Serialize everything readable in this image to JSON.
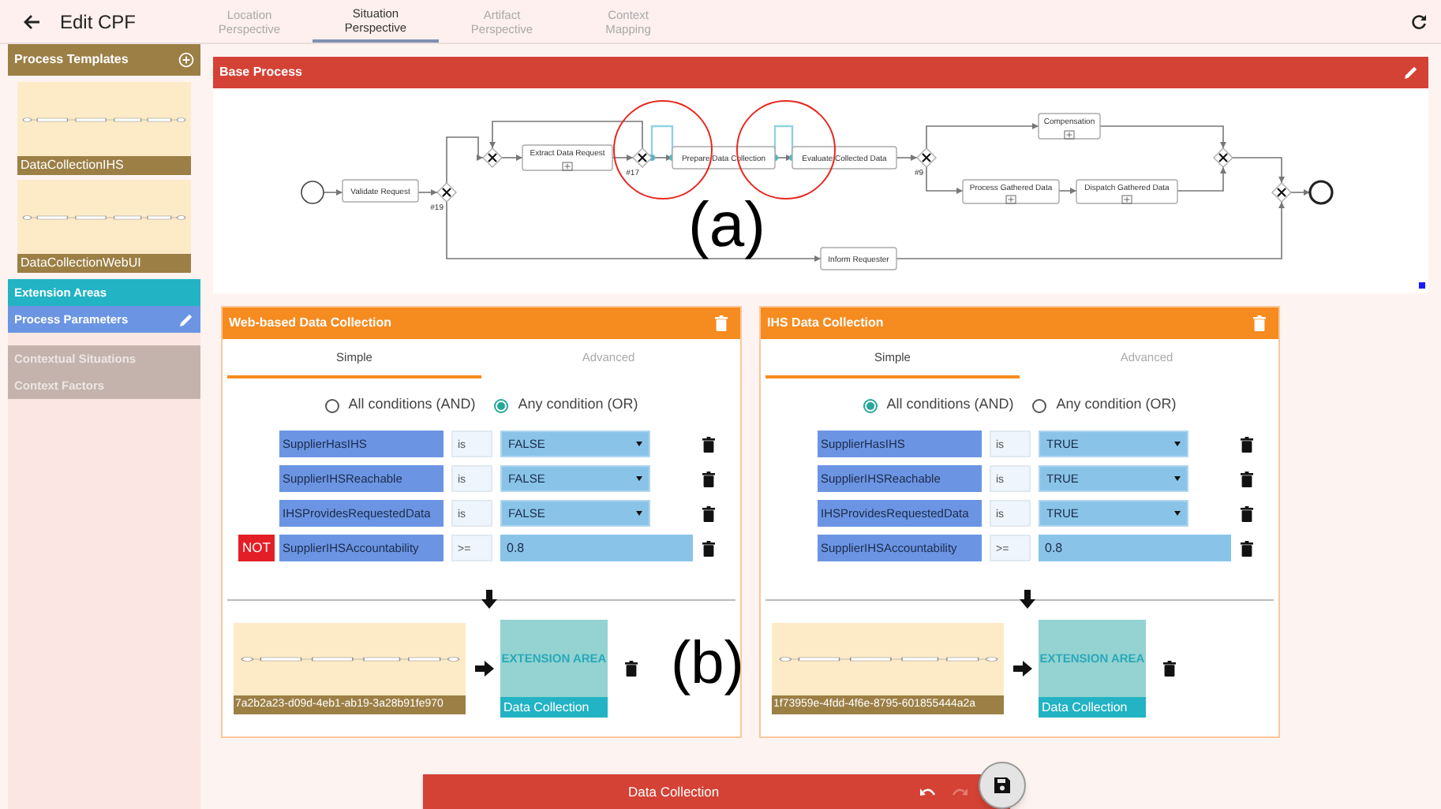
{
  "top_bar": {
    "title": "Edit CPF",
    "tabs": [
      {
        "label": "Location Perspective",
        "selected": false
      },
      {
        "label": "Situation Perspective",
        "selected": true
      },
      {
        "label": "Artifact Perspective",
        "selected": false
      },
      {
        "label": "Context Mapping",
        "selected": false
      }
    ]
  },
  "sidebar": {
    "templates_title": "Process Templates",
    "templates": [
      {
        "label": "DataCollectionIHS"
      },
      {
        "label": "DataCollectionWebUI"
      }
    ],
    "items": [
      {
        "label": "Extension Areas",
        "color": "#22b3c4",
        "editable": false,
        "disabled": false
      },
      {
        "label": "Process Parameters",
        "color": "#6b95e3",
        "editable": true,
        "disabled": false
      },
      {
        "label": "Contextual Situations",
        "editable": false,
        "disabled": true
      },
      {
        "label": "Context Factors",
        "editable": false,
        "disabled": true
      }
    ]
  },
  "base_process": {
    "title": "Base Process",
    "tasks": [
      {
        "label": "Validate Request",
        "subprocess": false
      },
      {
        "label": "Extract Data Request",
        "subprocess": true
      },
      {
        "label": "Prepare Data Collection",
        "subprocess": false
      },
      {
        "label": "Evaluate Collected Data",
        "subprocess": false
      },
      {
        "label": "Compensation",
        "subprocess": true
      },
      {
        "label": "Process Gathered Data",
        "subprocess": true
      },
      {
        "label": "Dispatch Gathered Data",
        "subprocess": true
      },
      {
        "label": "Inform Requester",
        "subprocess": false
      }
    ],
    "gateway_labels": [
      "#19",
      "#17",
      "#9"
    ],
    "annotation": "(a)"
  },
  "situations": [
    {
      "title": "Web-based Data Collection",
      "tabs": [
        {
          "label": "Simple",
          "selected": true
        },
        {
          "label": "Advanced",
          "selected": false
        }
      ],
      "modes": [
        {
          "label": "All conditions (AND)",
          "selected": false
        },
        {
          "label": "Any condition (OR)",
          "selected": true
        }
      ],
      "conditions": [
        {
          "negated": false,
          "factor": "SupplierHasIHS",
          "operator": "is",
          "value": "FALSE",
          "kind": "select"
        },
        {
          "negated": false,
          "factor": "SupplierIHSReachable",
          "operator": "is",
          "value": "FALSE",
          "kind": "select"
        },
        {
          "negated": false,
          "factor": "IHSProvidesRequestedData",
          "operator": "is",
          "value": "FALSE",
          "kind": "select"
        },
        {
          "negated": true,
          "negation_label": "NOT",
          "factor": "SupplierIHSAccountability",
          "operator": ">=",
          "value": "0.8",
          "kind": "number"
        }
      ],
      "template": "7a2b2a23-d09d-4eb1-ab19-3a28b91fe970",
      "extension_area": {
        "heading": "EXTENSION AREA",
        "label": "Data Collection"
      },
      "annotation": "(b)"
    },
    {
      "title": "IHS Data Collection",
      "tabs": [
        {
          "label": "Simple",
          "selected": true
        },
        {
          "label": "Advanced",
          "selected": false
        }
      ],
      "modes": [
        {
          "label": "All conditions (AND)",
          "selected": true
        },
        {
          "label": "Any condition (OR)",
          "selected": false
        }
      ],
      "conditions": [
        {
          "negated": false,
          "factor": "SupplierHasIHS",
          "operator": "is",
          "value": "TRUE",
          "kind": "select"
        },
        {
          "negated": false,
          "factor": "SupplierIHSReachable",
          "operator": "is",
          "value": "TRUE",
          "kind": "select"
        },
        {
          "negated": false,
          "factor": "IHSProvidesRequestedData",
          "operator": "is",
          "value": "TRUE",
          "kind": "select"
        },
        {
          "negated": false,
          "factor": "SupplierIHSAccountability",
          "operator": ">=",
          "value": "0.8",
          "kind": "number"
        }
      ],
      "template": "1f73959e-4fdd-4f6e-8795-601855444a2a",
      "extension_area": {
        "heading": "EXTENSION AREA",
        "label": "Data Collection"
      }
    }
  ],
  "bottom_bar": {
    "title": "Data Collection",
    "undo_disabled": false,
    "redo_disabled": true
  }
}
